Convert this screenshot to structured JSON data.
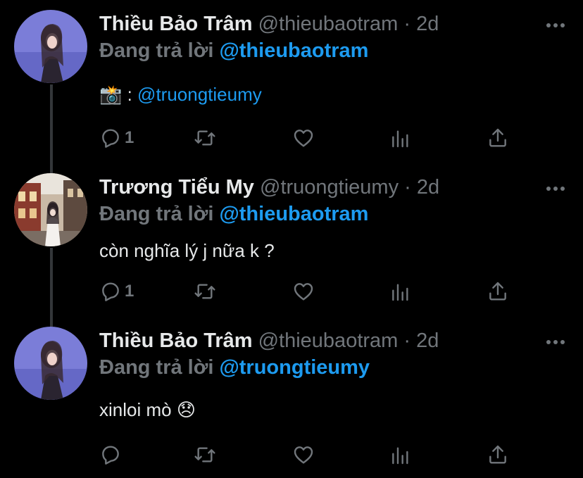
{
  "tweets": [
    {
      "name": "Thiều Bảo Trâm",
      "handle": "@thieubaotram",
      "time": "2d",
      "reply_prefix": "Đang trả lời",
      "reply_handle": "@thieubaotram",
      "body_emoji": "📸",
      "body_text": " : ",
      "body_mention": "@truongtieumy",
      "reply_count": "1"
    },
    {
      "name": "Trương Tiểu My",
      "handle": "@truongtieumy",
      "time": "2d",
      "reply_prefix": "Đang trả lời",
      "reply_handle": "@thieubaotram",
      "body_text": "còn nghĩa lý j nữa k ?",
      "reply_count": "1"
    },
    {
      "name": "Thiều Bảo Trâm",
      "handle": "@thieubaotram",
      "time": "2d",
      "reply_prefix": "Đang trả lời",
      "reply_handle": "@truongtieumy",
      "body_text": "xinloi mò ",
      "body_emoji": "😞",
      "reply_count": ""
    }
  ],
  "separator": "·",
  "icons": [
    "reply-icon",
    "retweet-icon",
    "like-icon",
    "analytics-icon",
    "share-icon",
    "more-icon"
  ],
  "colors": {
    "background": "#000000",
    "link": "#1d9bf0",
    "muted": "#71767b",
    "text": "#e7e9ea",
    "thread_line": "#333639"
  }
}
